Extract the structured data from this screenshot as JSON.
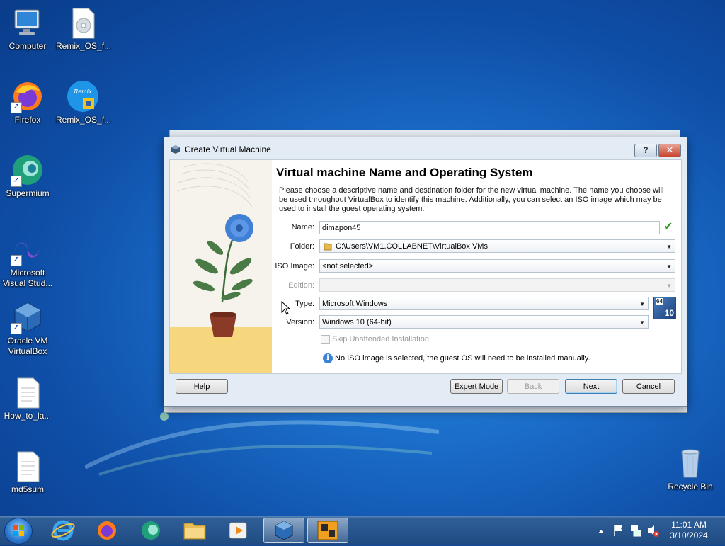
{
  "desktop": {
    "icons": [
      {
        "label": "Computer"
      },
      {
        "label": "Remix_OS_f..."
      },
      {
        "label": "Firefox"
      },
      {
        "label": "Remix_OS_f..."
      },
      {
        "label": "Supermium"
      },
      {
        "label": "Microsoft Visual Stud..."
      },
      {
        "label": "Oracle VM VirtualBox"
      },
      {
        "label": "How_to_la..."
      },
      {
        "label": "md5sum"
      },
      {
        "label": "Recycle Bin"
      }
    ]
  },
  "dialog": {
    "title": "Create Virtual Machine",
    "help_glyph": "?",
    "close_glyph": "✕",
    "heading": "Virtual machine Name and Operating System",
    "description": "Please choose a descriptive name and destination folder for the new virtual machine. The name you choose will be used throughout VirtualBox to identify this machine. Additionally, you can select an ISO image which may be used to install the guest operating system.",
    "fields": {
      "name_label": "Name:",
      "name_value": "dimapon45",
      "folder_label": "Folder:",
      "folder_value": "C:\\Users\\VM1.COLLABNET\\VirtualBox VMs",
      "iso_label": "ISO Image:",
      "iso_value": "<not selected>",
      "edition_label": "Edition:",
      "edition_value": "",
      "type_label": "Type:",
      "type_value": "Microsoft Windows",
      "version_label": "Version:",
      "version_value": "Windows 10 (64-bit)",
      "os_badge_top": "64",
      "os_badge_bottom": "10"
    },
    "skip_unattended_label": "Skip Unattended Installation",
    "skip_unattended_checked": false,
    "info_message": "No ISO image is selected, the guest OS will need to be installed manually.",
    "buttons": {
      "help": "Help",
      "expert": "Expert Mode",
      "back": "Back",
      "next": "Next",
      "cancel": "Cancel"
    }
  },
  "taskbar": {
    "clock_time": "11:01 AM",
    "clock_date": "3/10/2024"
  },
  "colors": {
    "desktop": "#1a6cc8",
    "taskbar": "#1f4b82",
    "check_green": "#2e9a1e",
    "info_blue": "#3b82d6"
  }
}
